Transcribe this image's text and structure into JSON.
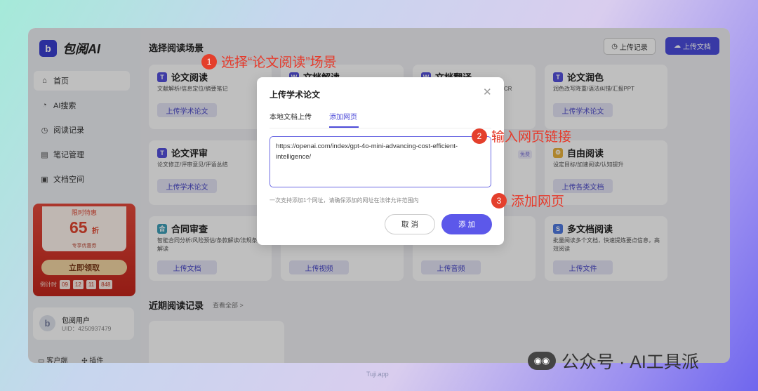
{
  "app": {
    "logo_letter": "b",
    "name": "包阅AI"
  },
  "sidebar": {
    "items": [
      {
        "icon": "home-icon",
        "glyph": "⌂",
        "label": "首页"
      },
      {
        "icon": "ai-search-icon",
        "glyph": "◔",
        "label": "AI搜索"
      },
      {
        "icon": "history-icon",
        "glyph": "◷",
        "label": "阅读记录"
      },
      {
        "icon": "notes-icon",
        "glyph": "▤",
        "label": "笔记管理"
      },
      {
        "icon": "docs-space-icon",
        "glyph": "▣",
        "label": "文档空间"
      }
    ]
  },
  "promo": {
    "tag": "限时特惠",
    "discount": "65",
    "unit": "折",
    "subtitle": "专享优惠券",
    "button": "立即领取",
    "countdown_label": "倒计时",
    "countdown": [
      "09",
      "12",
      "11",
      "848"
    ]
  },
  "user": {
    "avatar_letter": "b",
    "name": "包阅用户",
    "uid": "UID：4250937479"
  },
  "footer": {
    "client": "客户端",
    "plugin": "插件"
  },
  "main": {
    "title": "选择阅读场景",
    "upload_history": "上传记录",
    "upload_doc": "上传文档",
    "cards": [
      {
        "icon": "T",
        "title": "论文阅读",
        "desc": "文献解析/信息定位/摘要笔记",
        "button": "上传学术论文",
        "badge": ""
      },
      {
        "icon": "W",
        "title": "文档解读",
        "desc": "",
        "button": "",
        "badge": ""
      },
      {
        "icon": "W",
        "title": "文档翻译",
        "desc": "CR",
        "button": "",
        "badge": ""
      },
      {
        "icon": "T",
        "title": "论文润色",
        "desc": "润色改写降重/语法纠错/汇报PPT",
        "button": "上传学术论文",
        "badge": ""
      },
      {
        "icon": "T",
        "title": "论文评审",
        "desc": "论文修正/评审意见/评语总结",
        "button": "上传学术论文",
        "badge": ""
      },
      {
        "icon": "",
        "title": "",
        "desc": "",
        "button": "",
        "badge": ""
      },
      {
        "icon": "",
        "title": "",
        "desc": "",
        "button": "",
        "badge": "免费"
      },
      {
        "icon": "⚙",
        "title": "自由阅读",
        "desc": "设定目标/加速阅读/认知提升",
        "button": "上传各类文档",
        "badge": ""
      },
      {
        "icon": "合",
        "title": "合同审查",
        "desc": "智能合同分析/风险预估/条款解读/法规条款解读",
        "button": "上传文档",
        "badge": ""
      },
      {
        "icon": "",
        "title": "",
        "desc": "",
        "button": "上传视频",
        "badge": ""
      },
      {
        "icon": "",
        "title": "",
        "desc": "",
        "button": "上传音频",
        "badge": ""
      },
      {
        "icon": "S",
        "title": "多文档阅读",
        "desc": "批量阅读多个文档，快速提炼要点信息，高效阅读",
        "button": "上传文件",
        "badge": ""
      }
    ],
    "recent_title": "近期阅读记录",
    "recent_link": "查看全部 >"
  },
  "modal": {
    "title": "上传学术论文",
    "tab_local": "本地文档上传",
    "tab_web": "添加网页",
    "url_value": "https://openai.com/index/gpt-4o-mini-advancing-cost-efficient-intelligence/",
    "note": "一次支持添加1个网址，请确保添加的网址在法律允许范围内",
    "cancel": "取 消",
    "add": "添 加"
  },
  "annotations": [
    {
      "num": "1",
      "text": "选择“论文阅读”场景"
    },
    {
      "num": "2",
      "text": "输入网页链接"
    },
    {
      "num": "3",
      "text": "添加网页"
    }
  ],
  "watermark": {
    "source": "Tuji.app",
    "brand": "公众号 · AI工具派"
  },
  "colors": {
    "accent": "#4b4ddc",
    "annotation": "#e53b2c",
    "promo": "#d63a2d"
  }
}
